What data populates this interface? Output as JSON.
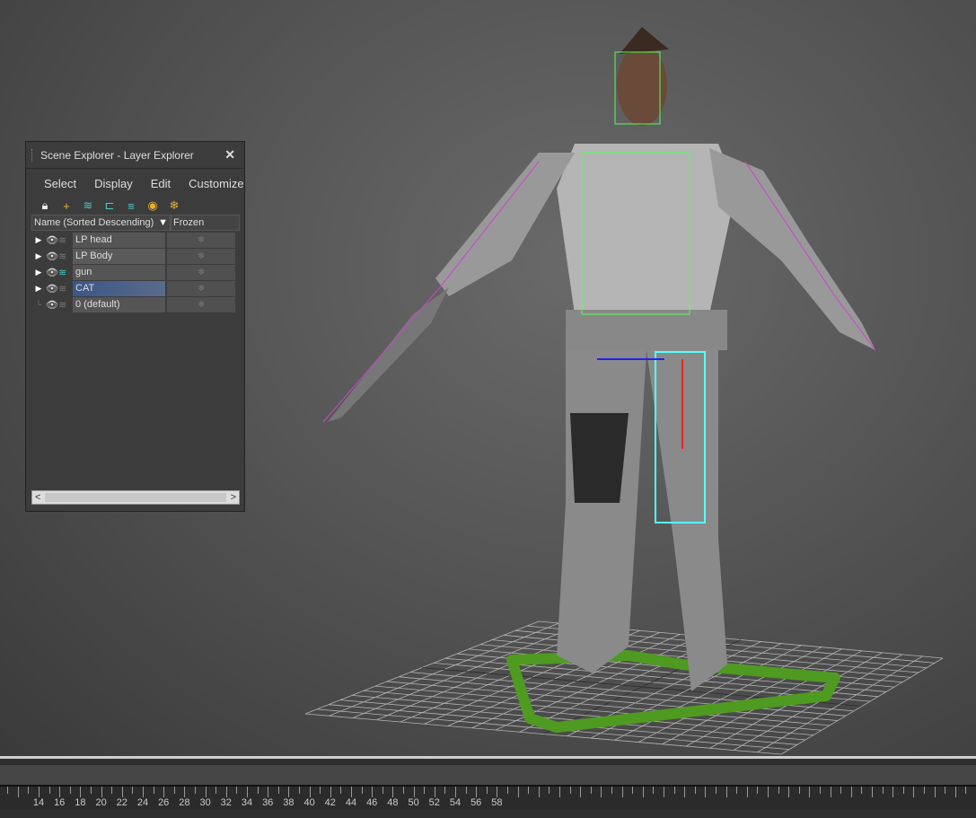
{
  "panel": {
    "title": "Scene Explorer - Layer Explorer",
    "close_label": "✕",
    "menu": [
      "Select",
      "Display",
      "Edit",
      "Customize"
    ],
    "toolbar_icons": [
      "lock-icon",
      "add-layer-icon",
      "add-to-layer-icon",
      "hierarchy-icon",
      "layers-icon",
      "hide-icon",
      "freeze-icon"
    ],
    "columns": [
      "Name (Sorted Descending)",
      "Frozen"
    ],
    "sort_indicator": "▼",
    "layers": [
      {
        "name": "LP head",
        "expandable": true,
        "active": false,
        "selected": false
      },
      {
        "name": "LP Body",
        "expandable": true,
        "active": false,
        "selected": false
      },
      {
        "name": "gun",
        "expandable": true,
        "active": true,
        "selected": false
      },
      {
        "name": "CAT",
        "expandable": true,
        "active": false,
        "selected": true
      },
      {
        "name": "0 (default)",
        "expandable": false,
        "active": false,
        "selected": false
      }
    ],
    "scroll_left": "<",
    "scroll_right": ">"
  },
  "timeline": {
    "labels": [
      "14",
      "16",
      "18",
      "20",
      "22",
      "24",
      "26",
      "28",
      "30",
      "32",
      "34",
      "36",
      "38",
      "40",
      "42",
      "44",
      "46",
      "48",
      "50",
      "52",
      "54",
      "56",
      "58"
    ]
  }
}
